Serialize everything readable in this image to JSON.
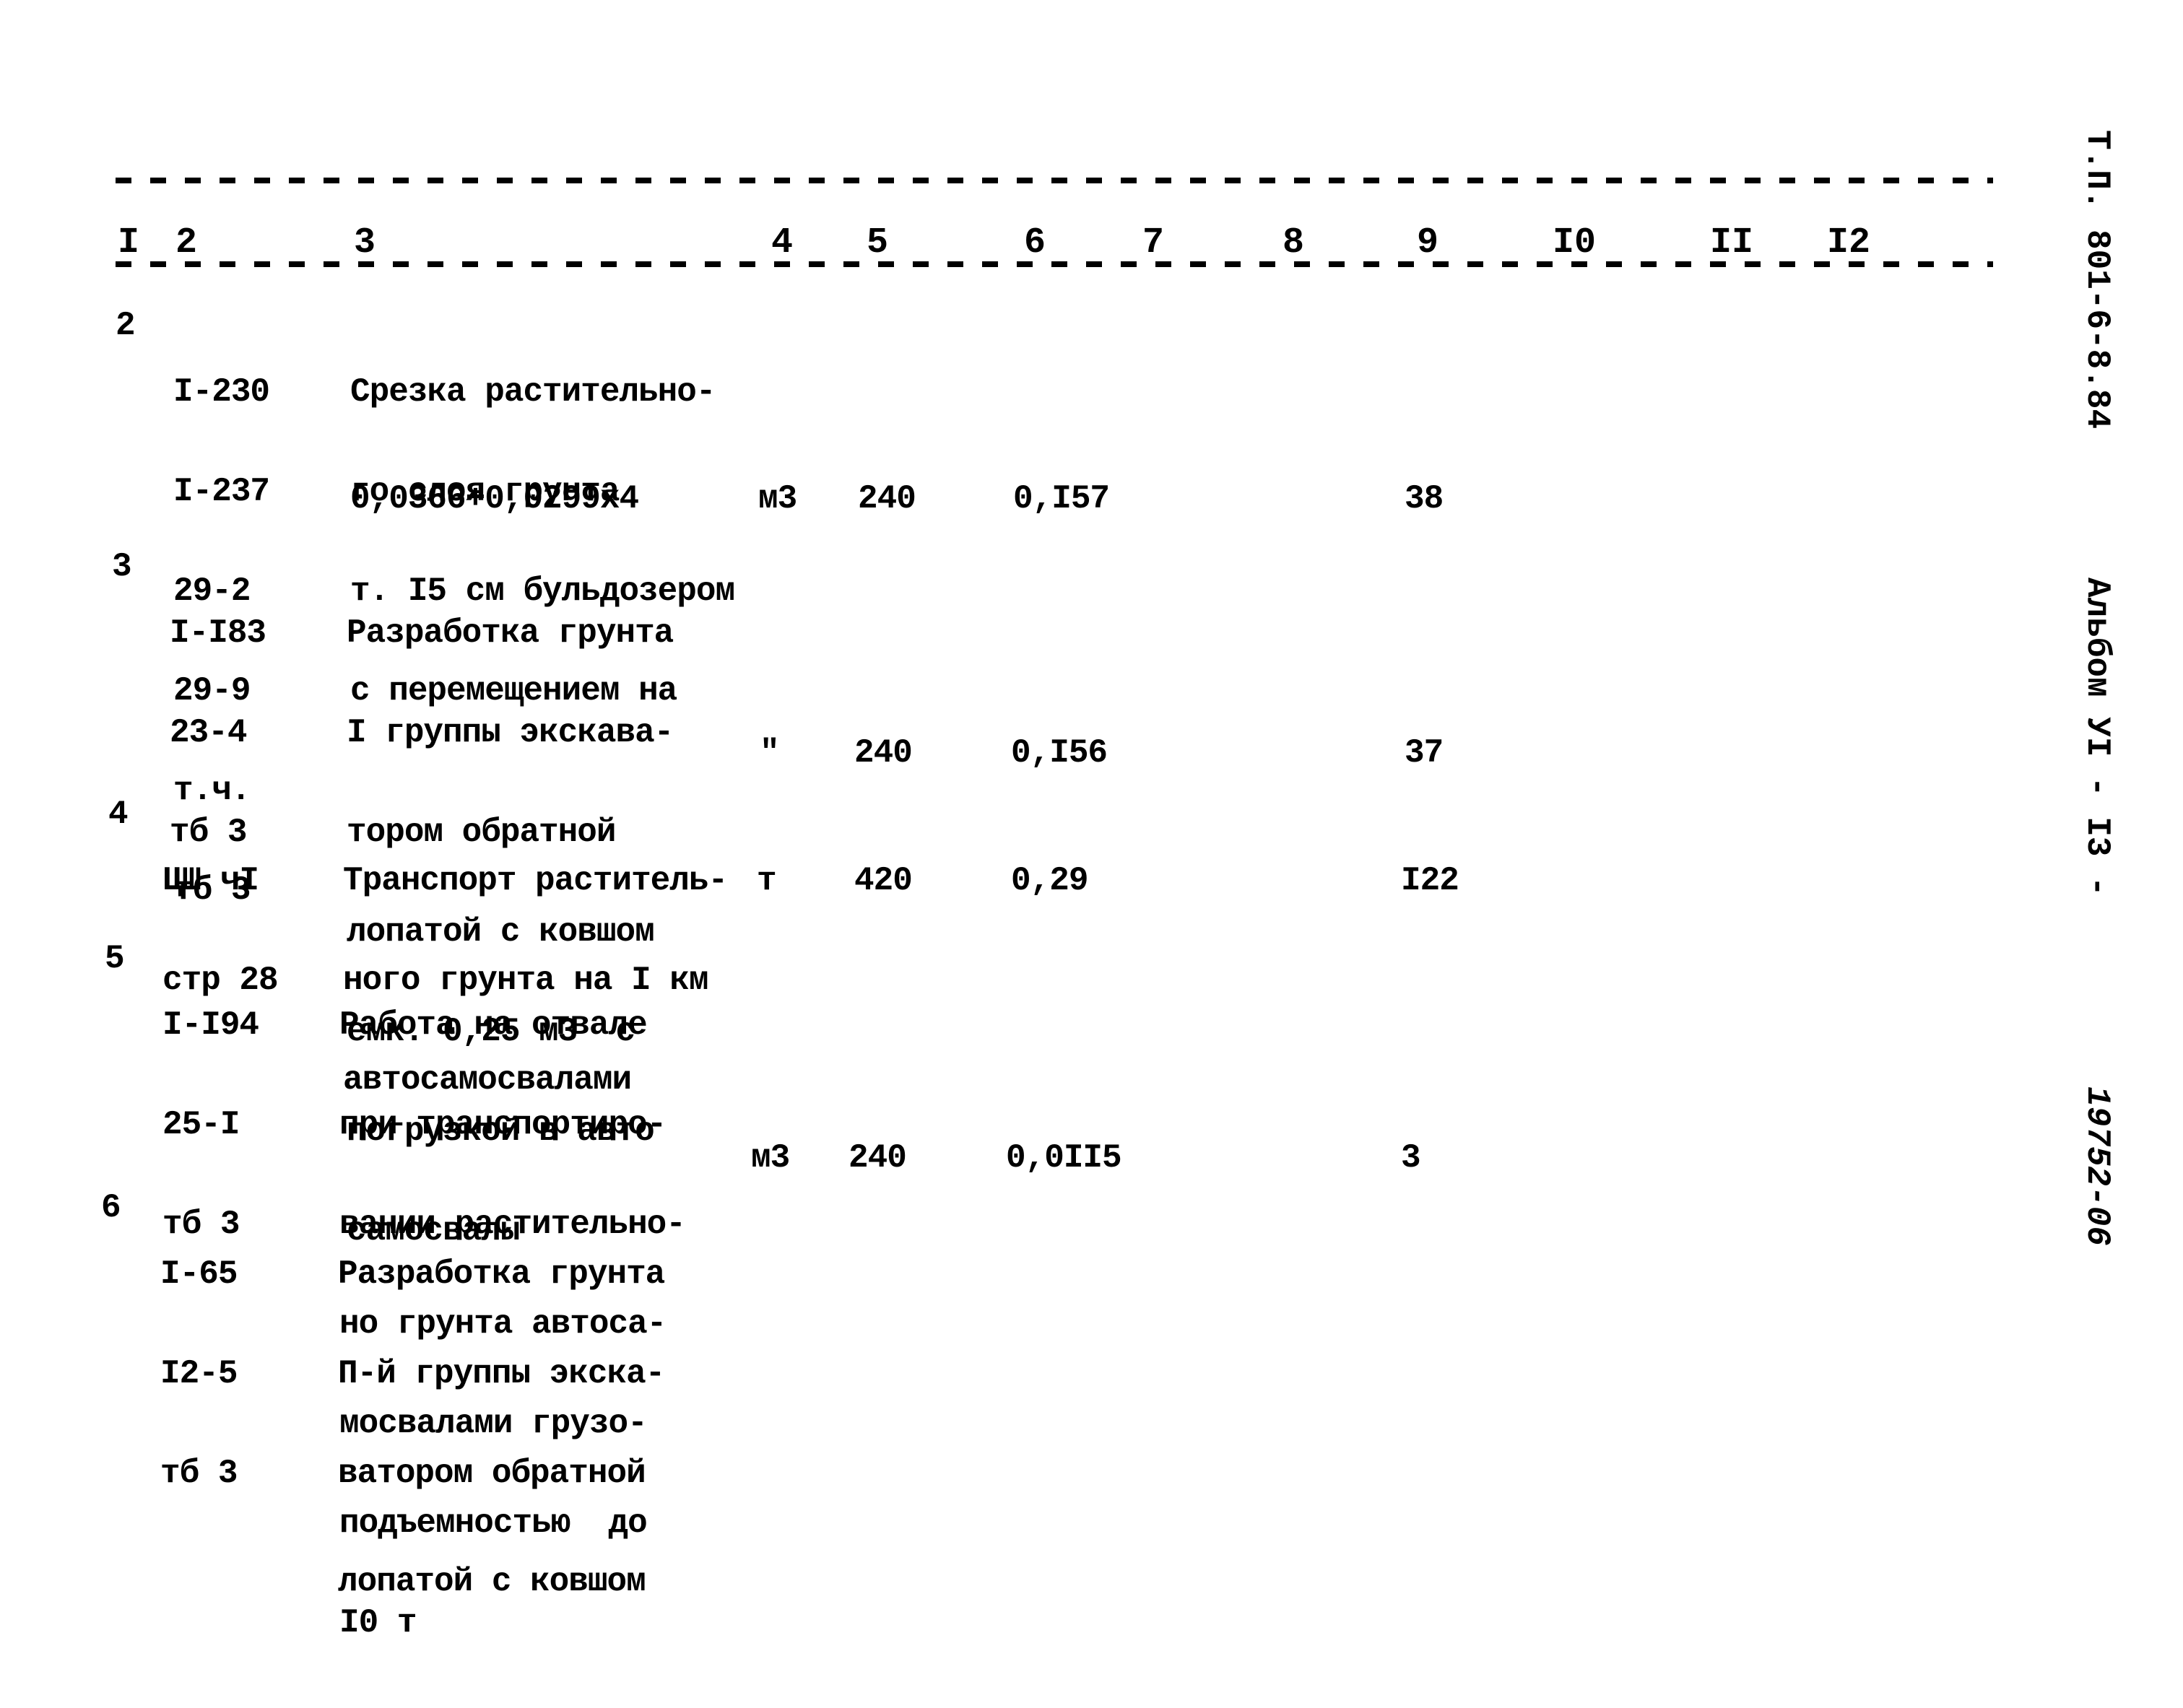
{
  "side_labels": {
    "project": "Т.П. 801-6-8.84",
    "album": "Альбом УI - I3 -",
    "code": "19752-06"
  },
  "header": {
    "columns": [
      "I",
      "2",
      "3",
      "4",
      "5",
      "6",
      "7",
      "8",
      "9",
      "I0",
      "II",
      "I2"
    ]
  },
  "rows": [
    {
      "num": "2",
      "refs": [
        "I-230",
        "I-237",
        "29-2",
        "29-9",
        "т.ч.",
        "тб 3"
      ],
      "desc": [
        "Срезка растительно-",
        "го слоя грунта",
        "т. I5 см бульдозером",
        "с перемещением на"
      ],
      "formula": "0,0366+0,0299х4",
      "unit": "м3",
      "qty": "240",
      "norm": "0,I57",
      "total": "38"
    },
    {
      "num": "3",
      "refs": [
        "I-I83",
        "23-4",
        "тб 3"
      ],
      "desc": [
        "Разработка грунта",
        "I группы экскава-",
        "тором обратной",
        "лопатой с ковшом",
        "емк. 0,25 м3  с",
        "погрузкой в авто",
        "самосвалы"
      ],
      "formula": "",
      "unit": "\"",
      "qty": "240",
      "norm": "0,I56",
      "total": "37"
    },
    {
      "num": "4",
      "refs": [
        "ЦШ чI",
        "стр 28"
      ],
      "desc": [
        "Транспорт раститель-",
        "ного грунта на I км",
        "автосамосвалами"
      ],
      "formula": "",
      "unit": "т",
      "qty": "420",
      "norm": "0,29",
      "total": "I22"
    },
    {
      "num": "5",
      "refs": [
        "I-I94",
        "25-I",
        "тб 3"
      ],
      "desc": [
        "Работа на отвале",
        "при транспортиро-",
        "вании растительно-",
        "но грунта автоса-",
        "мосвалами грузо-",
        "подъемностью  до",
        "I0 т"
      ],
      "formula": "",
      "unit": "м3",
      "qty": "240",
      "norm": "0,0II5",
      "total": "3"
    },
    {
      "num": "6",
      "refs": [
        "I-65",
        "I2-5",
        "тб 3"
      ],
      "desc": [
        "Разработка грунта",
        "П-й группы экска-",
        "ватором обратной",
        "лопатой с ковшом"
      ],
      "formula": "",
      "unit": "",
      "qty": "",
      "norm": "",
      "total": ""
    }
  ]
}
